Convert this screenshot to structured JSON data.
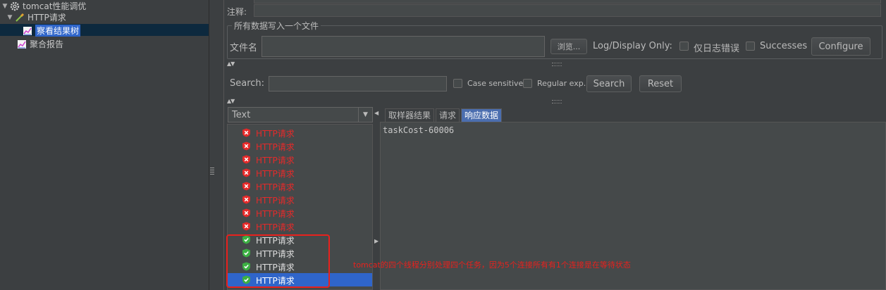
{
  "tree": {
    "items": [
      {
        "label": "tomcat性能调优",
        "icon": "gear-icon",
        "expanded": true
      },
      {
        "label": "HTTP请求",
        "icon": "pipette-icon",
        "expanded": true
      },
      {
        "label": "察看结果树",
        "icon": "graph-icon",
        "selected": true
      },
      {
        "label": "聚合报告",
        "icon": "graph-icon"
      }
    ]
  },
  "comment": {
    "label": "注释:"
  },
  "write_all": {
    "title": "所有数据写入一个文件",
    "filename_label": "文件名",
    "browse_label": "浏览...",
    "log_display_label": "Log/Display Only:",
    "errors_only_label": "仅日志错误",
    "successes_label": "Successes",
    "configure_label": "Configure"
  },
  "search": {
    "label": "Search:",
    "case_sensitive_label": "Case sensitive",
    "regex_label": "Regular exp.",
    "search_button": "Search",
    "reset_button": "Reset"
  },
  "renderer": {
    "selected": "Text"
  },
  "results": [
    {
      "label": "HTTP请求",
      "status": "fail"
    },
    {
      "label": "HTTP请求",
      "status": "fail"
    },
    {
      "label": "HTTP请求",
      "status": "fail"
    },
    {
      "label": "HTTP请求",
      "status": "fail"
    },
    {
      "label": "HTTP请求",
      "status": "fail"
    },
    {
      "label": "HTTP请求",
      "status": "fail"
    },
    {
      "label": "HTTP请求",
      "status": "fail"
    },
    {
      "label": "HTTP请求",
      "status": "fail"
    },
    {
      "label": "HTTP请求",
      "status": "ok"
    },
    {
      "label": "HTTP请求",
      "status": "ok"
    },
    {
      "label": "HTTP请求",
      "status": "ok"
    },
    {
      "label": "HTTP请求",
      "status": "ok",
      "selected": true
    }
  ],
  "tabs": [
    {
      "label": "取样器结果"
    },
    {
      "label": "请求"
    },
    {
      "label": "响应数据",
      "active": true
    }
  ],
  "response": {
    "text": "taskCost-60006"
  },
  "annotation": {
    "text": "tomcat的四个线程分别处理四个任务，因为5个连接所有有1个连接是在等待状态"
  },
  "colors": {
    "fail": "#e52a2a",
    "ok": "#3cb043",
    "annotation": "#e8211d",
    "selection": "#2f65ca"
  }
}
